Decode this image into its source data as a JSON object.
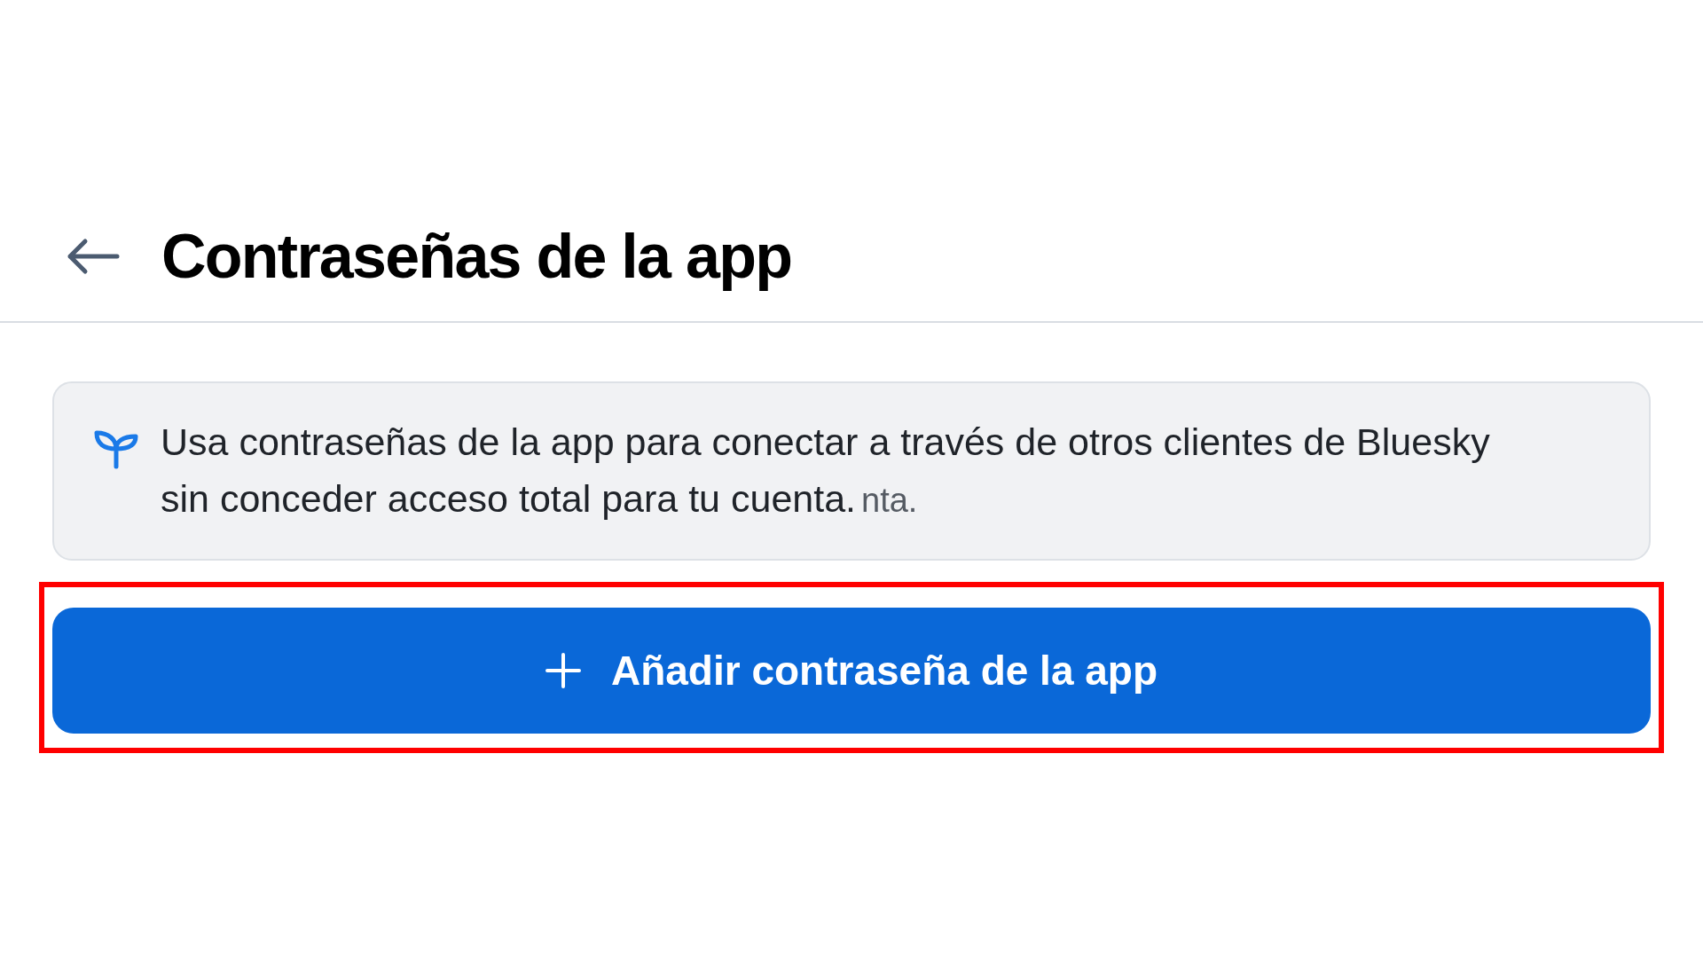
{
  "header": {
    "title": "Contraseñas de la app"
  },
  "info": {
    "text": "Usa contraseñas de la app para conectar a través de otros clientes de Bluesky sin conceder acceso total para tu cuenta.",
    "overlay_text": "nta."
  },
  "add_button": {
    "label": "Añadir contraseña de la app",
    "highlighted": true
  }
}
